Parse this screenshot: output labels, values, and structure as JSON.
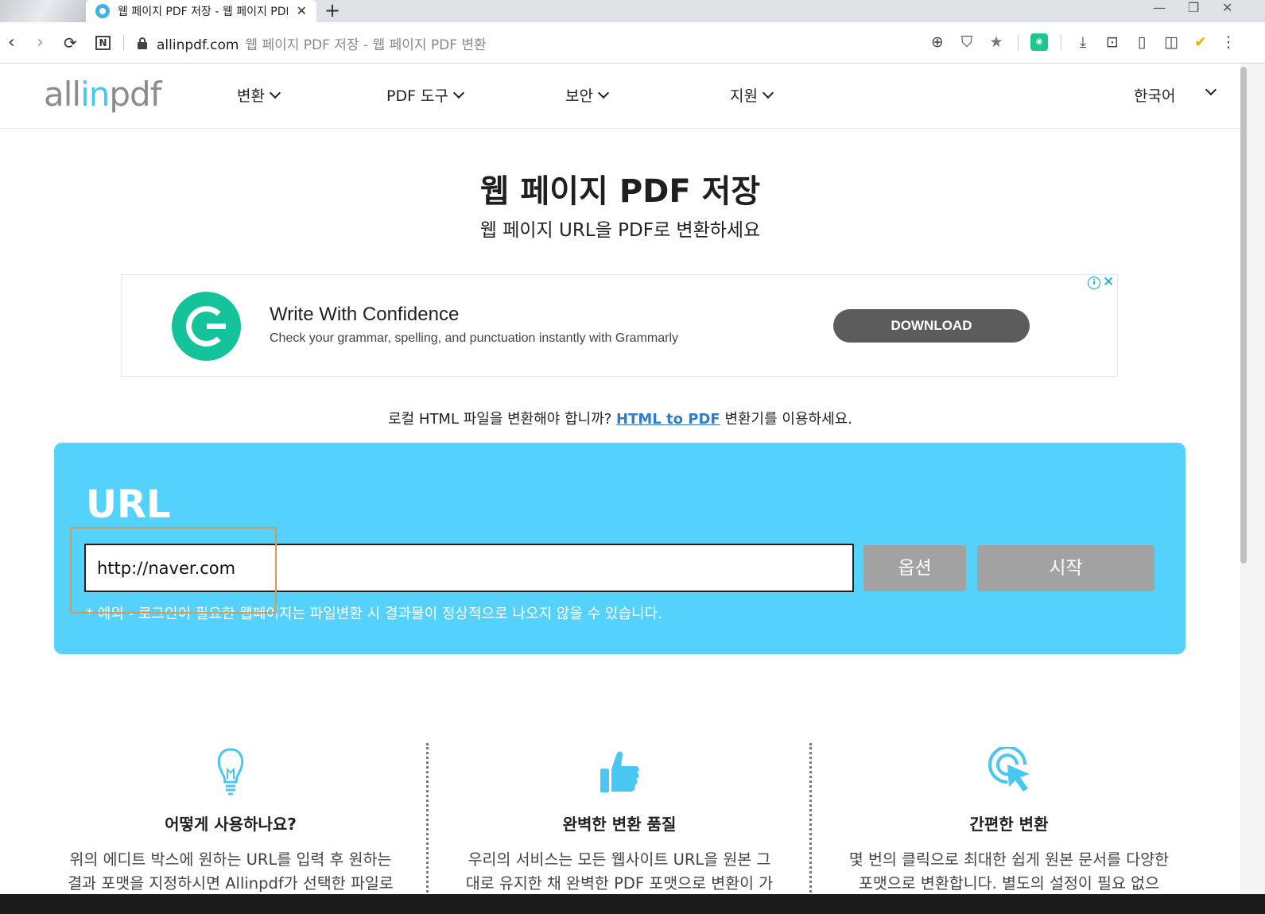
{
  "browser": {
    "tab_title": "웹 페이지 PDF 저장 - 웹 페이지 PDF 변환",
    "new_tab": "+",
    "tab_close": "✕",
    "address": {
      "domain": "allinpdf.com",
      "page_title": "웹 페이지 PDF 저장 - 웹 페이지 PDF 변환"
    },
    "nav_icons": [
      "back-icon",
      "forward-icon",
      "reload-icon",
      "notion-icon"
    ],
    "toolbar_icons": [
      "zoom-icon",
      "shield-icon",
      "bookmark-star-icon",
      "extension-icon",
      "download-icon",
      "camera-icon",
      "reader-icon",
      "sidebar-icon",
      "check-icon",
      "menu-icon"
    ],
    "window_controls": [
      "minimize",
      "restore",
      "close"
    ]
  },
  "site": {
    "logo": {
      "part1": "all",
      "part2": "in",
      "part3": "pdf"
    },
    "menu": [
      "변환",
      "PDF 도구",
      "보안",
      "지원"
    ],
    "language": "한국어"
  },
  "hero": {
    "title": "웹 페이지 PDF 저장",
    "subtitle": "웹 페이지 URL을 PDF로 변환하세요"
  },
  "ad": {
    "title": "Write With Confidence",
    "description": "Check your grammar, spelling, and punctuation instantly with Grammarly",
    "button": "DOWNLOAD",
    "info": "i",
    "close": "✕"
  },
  "notice": {
    "before": "로컬 HTML 파일을 변환해야 합니까? ",
    "link": "HTML to PDF",
    "after": " 변환기를 이용하세요."
  },
  "converter": {
    "label": "URL",
    "input_value": "http://naver.com",
    "options_button": "옵션",
    "start_button": "시작",
    "note": "* 예외 - 로그인이 필요한 웹페이지는 파일변환 시 결과물이 정상적으로 나오지 않을 수 있습니다."
  },
  "features": [
    {
      "icon": "lightbulb-icon",
      "title": "어떻게 사용하나요?",
      "desc_line1": "위의 에디트 박스에 원하는 URL를 입력 후 원하는",
      "desc_line2": "결과 포맷을 지정하시면 Allinpdf가 선택한 파일로"
    },
    {
      "icon": "thumbs-up-icon",
      "title": "완벽한 변환 품질",
      "desc_line1": "우리의 서비스는 모든 웹사이트 URL을 원본 그",
      "desc_line2": "대로 유지한 채 완벽한 PDF 포맷으로 변환이 가"
    },
    {
      "icon": "click-cursor-icon",
      "title": "간편한 변환",
      "desc_line1": "몇 번의 클릭으로 최대한 쉽게 원본 문서를 다양한",
      "desc_line2": "포맷으로 변환합니다. 별도의 설정이 필요 없으"
    }
  ],
  "colors": {
    "accent": "#55d2fc",
    "link": "#2f7ec7",
    "button_disabled": "#a2a2a2",
    "ad_brand": "#15c39a"
  }
}
